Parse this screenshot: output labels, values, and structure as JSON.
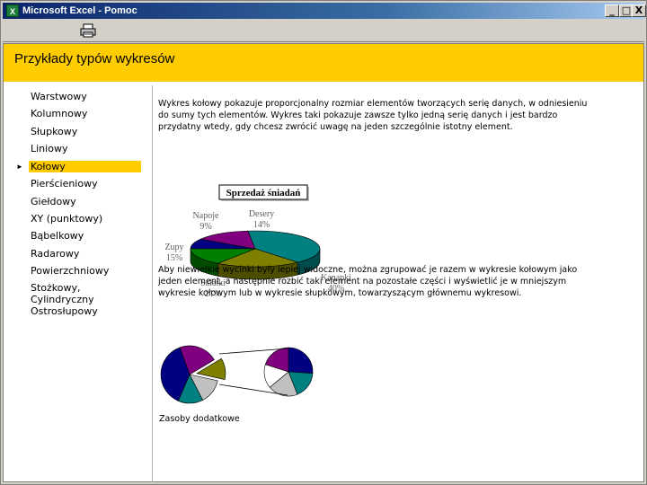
{
  "window": {
    "title": "Microsoft Excel - Pomoc",
    "minimize": "_",
    "maximize": "□",
    "close": "X"
  },
  "toolbar": {
    "print_icon": "printer-icon"
  },
  "page": {
    "title": "Przykłady typów wykresów"
  },
  "nav": {
    "items": [
      {
        "label": "Warstwowy"
      },
      {
        "label": "Kolumnowy"
      },
      {
        "label": "Słupkowy"
      },
      {
        "label": "Liniowy"
      },
      {
        "label": "Kołowy",
        "active": true
      },
      {
        "label": "Pierścieniowy"
      },
      {
        "label": "Giełdowy"
      },
      {
        "label": "XY (punktowy)"
      },
      {
        "label": "Bąbelkowy"
      },
      {
        "label": "Radarowy"
      },
      {
        "label": "Powierzchniowy"
      },
      {
        "label": "Stożkowy,"
      },
      {
        "label": "Cylindryczny"
      },
      {
        "label": "Ostrosłupowy"
      }
    ]
  },
  "main": {
    "para1": [
      "Wykres kołowy pokazuje proporcjonalny rozmiar elementów tworzących serię danych, w odniesieniu",
      "do sumy tych elementów. Wykres taki pokazuje zawsze tylko jedną serię danych i jest bardzo",
      "przydatny wtedy, gdy chcesz zwrócić uwagę na jeden szczególnie istotny element."
    ],
    "para2": [
      "Aby niewielkie wycinki były lepiej widoczne, można zgrupować je razem w wykresie kołowym jako",
      "jeden element, a następnie rozbić taki element na pozostałe części i wyświetlić je w mniejszym",
      "wykresie kołowym lub w wykresie słupkowym, towarzyszącym głównemu wykresowi."
    ],
    "caption": "Zasoby dodatkowe"
  },
  "chart_data": [
    {
      "type": "pie",
      "title": "Sprzedaż śniadań",
      "slices": [
        {
          "label": "Napoje",
          "value": 9,
          "pct": "9%",
          "color": "#000080"
        },
        {
          "label": "Desery",
          "value": 14,
          "pct": "14%",
          "color": "#800080"
        },
        {
          "label": "Kanapki",
          "value": 40,
          "pct": "40%",
          "color": "#008080"
        },
        {
          "label": "Sałatki",
          "value": 21,
          "pct": "21%",
          "color": "#808000"
        },
        {
          "label": "Zupy",
          "value": 15,
          "pct": "15%",
          "color": "#008000"
        }
      ]
    },
    {
      "type": "pie",
      "title": "",
      "main_slices": [
        {
          "value": 22,
          "color": "#800080"
        },
        {
          "value": 12,
          "color": "#808000"
        },
        {
          "value": 14,
          "color": "#c0c0c0"
        },
        {
          "value": 14,
          "color": "#008080"
        },
        {
          "value": 38,
          "color": "#000080"
        }
      ],
      "detail_slices": [
        {
          "value": 26,
          "color": "#000080"
        },
        {
          "value": 18,
          "color": "#008080"
        },
        {
          "value": 20,
          "color": "#c0c0c0"
        },
        {
          "value": 16,
          "color": "#ffffff"
        },
        {
          "value": 20,
          "color": "#800080"
        }
      ]
    }
  ]
}
